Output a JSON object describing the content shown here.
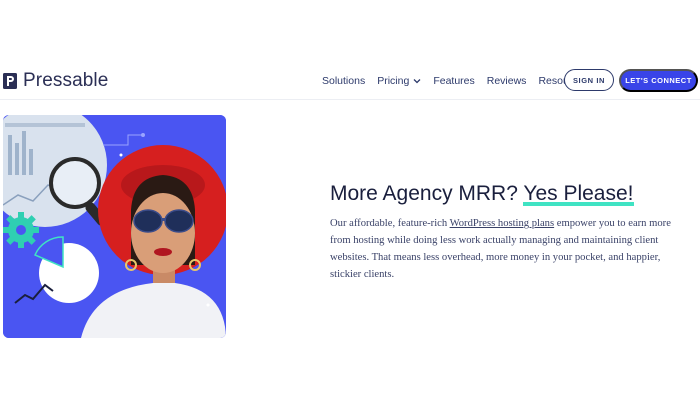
{
  "brand": {
    "name": "Pressable"
  },
  "nav": {
    "items": [
      {
        "label": "Solutions"
      },
      {
        "label": "Pricing"
      },
      {
        "label": "Features"
      },
      {
        "label": "Reviews"
      },
      {
        "label": "Resources"
      }
    ],
    "sign_in": "SIGN IN",
    "connect": "LET'S CONNECT"
  },
  "hero": {
    "headline_start": "More Agency MRR? ",
    "headline_accent": "Yes Please!",
    "body_before": "Our affordable, feature-rich ",
    "body_link": "WordPress hosting plans",
    "body_after": " empower you to earn more from hosting while doing less work actually managing and maintaining client websites. That means less overhead, more money in your pocket, and happier, stickier clients."
  },
  "colors": {
    "brand_blue": "#3944e8",
    "accent_teal": "#3fe3c3",
    "hero_bg": "#4a55f2",
    "hat_red": "#d61f1f",
    "text_dark": "#1a1f3d"
  },
  "icons": [
    "pressable-logo-icon",
    "chevron-down-icon",
    "gear-icon",
    "magnifier-icon",
    "pie-chart-icon",
    "line-chart-icon"
  ]
}
